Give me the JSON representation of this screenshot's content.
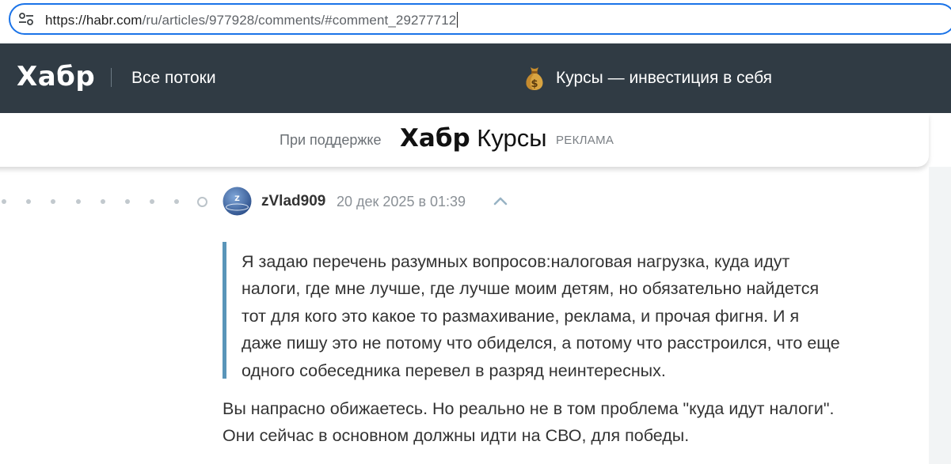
{
  "browser": {
    "url_host": "https://habr.com",
    "url_path": "/ru/articles/977928/comments/#comment_29277712",
    "site_info_icon": "tune-icon"
  },
  "header": {
    "logo": "Хабр",
    "all_streams": "Все потоки",
    "promo_icon": "money-bag-icon",
    "promo_text": "Курсы — инвестиция в себя",
    "background": "#303b44"
  },
  "sponsor": {
    "label": "При поддержке",
    "logo_bold": "Хабр",
    "logo_light": "Курсы",
    "ad_label": "РЕКЛАМА"
  },
  "comment": {
    "author": "zVlad909",
    "timestamp": "20 дек 2025 в 01:39",
    "quote_lines": [
      "Я задаю перечень разумных вопросов:налоговая нагрузка, куда идут",
      "налоги, где мне лучше, где лучше моим детям, но обязательно найдется",
      "тот для кого это какое то размахивание, реклама, и прочая фигня. И я",
      "даже пишу это не потому что обиделся, а потому что расстроился, что еще",
      "одного собеседника перевел в разряд неинтересных."
    ],
    "reply_lines": [
      "Вы напрасно обижаетесь. Но реально не в том проблема \"куда идут налоги\".",
      "Они сейчас в основном должны идти на СВО, для победы."
    ],
    "quote_border_color": "#5a95b9"
  }
}
